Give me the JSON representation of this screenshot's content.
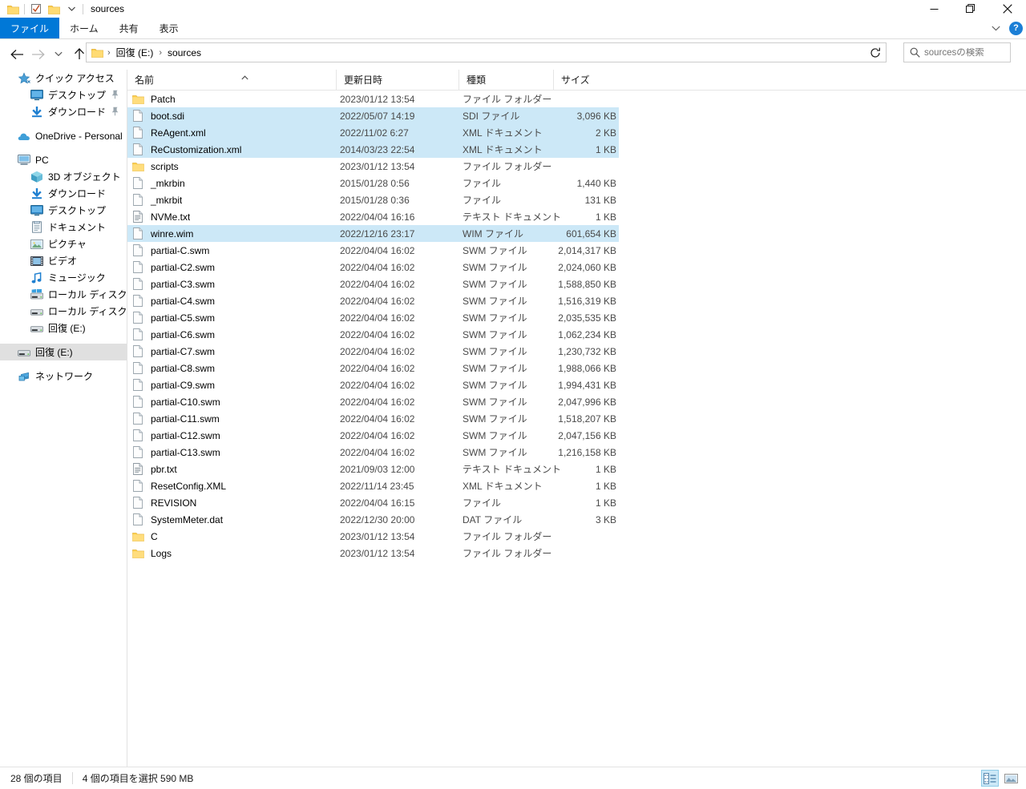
{
  "window": {
    "title": "sources",
    "minimize_label": "─",
    "maximize_label": "❐",
    "close_label": "✕",
    "help_label": "?"
  },
  "ribbon": {
    "tabs": [
      {
        "label": "ファイル",
        "active": true
      },
      {
        "label": "ホーム",
        "active": false
      },
      {
        "label": "共有",
        "active": false
      },
      {
        "label": "表示",
        "active": false
      }
    ]
  },
  "address": {
    "breadcrumbs": [
      "回復 (E:)",
      "sources"
    ],
    "separator": "›",
    "refresh_label": "↻"
  },
  "search": {
    "placeholder": "sourcesの検索",
    "value": ""
  },
  "sidebar": {
    "items": [
      {
        "label": "クイック アクセス",
        "icon": "star-icon",
        "indent": 0,
        "selected": false,
        "pinned": false
      },
      {
        "label": "デスクトップ",
        "icon": "desktop-icon",
        "indent": 1,
        "selected": false,
        "pinned": true
      },
      {
        "label": "ダウンロード",
        "icon": "download-icon",
        "indent": 1,
        "selected": false,
        "pinned": true
      },
      {
        "spacer": true
      },
      {
        "label": "OneDrive - Personal",
        "icon": "cloud-icon",
        "indent": 0,
        "selected": false,
        "pinned": false
      },
      {
        "spacer": true
      },
      {
        "label": "PC",
        "icon": "pc-icon",
        "indent": 0,
        "selected": false,
        "pinned": false
      },
      {
        "label": "3D オブジェクト",
        "icon": "cube-icon",
        "indent": 1,
        "selected": false,
        "pinned": false
      },
      {
        "label": "ダウンロード",
        "icon": "download-icon",
        "indent": 1,
        "selected": false,
        "pinned": false
      },
      {
        "label": "デスクトップ",
        "icon": "desktop-icon",
        "indent": 1,
        "selected": false,
        "pinned": false
      },
      {
        "label": "ドキュメント",
        "icon": "document-icon",
        "indent": 1,
        "selected": false,
        "pinned": false
      },
      {
        "label": "ピクチャ",
        "icon": "picture-icon",
        "indent": 1,
        "selected": false,
        "pinned": false
      },
      {
        "label": "ビデオ",
        "icon": "video-icon",
        "indent": 1,
        "selected": false,
        "pinned": false
      },
      {
        "label": "ミュージック",
        "icon": "music-icon",
        "indent": 1,
        "selected": false,
        "pinned": false
      },
      {
        "label": "ローカル ディスク (C:)",
        "icon": "windows-drive-icon",
        "indent": 1,
        "selected": false,
        "pinned": false
      },
      {
        "label": "ローカル ディスク (D:)",
        "icon": "drive-icon",
        "indent": 1,
        "selected": false,
        "pinned": false
      },
      {
        "label": "回復 (E:)",
        "icon": "drive-icon",
        "indent": 1,
        "selected": false,
        "pinned": false
      },
      {
        "spacer": true
      },
      {
        "label": "回復 (E:)",
        "icon": "drive-icon",
        "indent": 0,
        "selected": true,
        "pinned": false
      },
      {
        "spacer": true
      },
      {
        "label": "ネットワーク",
        "icon": "network-icon",
        "indent": 0,
        "selected": false,
        "pinned": false
      }
    ]
  },
  "filelist": {
    "columns": [
      {
        "label": "名前",
        "key": "name"
      },
      {
        "label": "更新日時",
        "key": "date"
      },
      {
        "label": "種類",
        "key": "type"
      },
      {
        "label": "サイズ",
        "key": "size"
      }
    ],
    "sort_column": "名前",
    "sort_direction": "ascending",
    "rows": [
      {
        "name": "Patch",
        "date": "2023/01/12 13:54",
        "type": "ファイル フォルダー",
        "size": "",
        "icon": "folder-icon",
        "selected": false
      },
      {
        "name": "boot.sdi",
        "date": "2022/05/07 14:19",
        "type": "SDI ファイル",
        "size": "3,096 KB",
        "icon": "file-icon",
        "selected": true
      },
      {
        "name": "ReAgent.xml",
        "date": "2022/11/02 6:27",
        "type": "XML ドキュメント",
        "size": "2 KB",
        "icon": "file-icon",
        "selected": true
      },
      {
        "name": "ReCustomization.xml",
        "date": "2014/03/23 22:54",
        "type": "XML ドキュメント",
        "size": "1 KB",
        "icon": "file-icon",
        "selected": true
      },
      {
        "name": "scripts",
        "date": "2023/01/12 13:54",
        "type": "ファイル フォルダー",
        "size": "",
        "icon": "folder-icon",
        "selected": false
      },
      {
        "name": "_mkrbin",
        "date": "2015/01/28 0:56",
        "type": "ファイル",
        "size": "1,440 KB",
        "icon": "file-icon",
        "selected": false
      },
      {
        "name": "_mkrbit",
        "date": "2015/01/28 0:36",
        "type": "ファイル",
        "size": "131 KB",
        "icon": "file-icon",
        "selected": false
      },
      {
        "name": "NVMe.txt",
        "date": "2022/04/04 16:16",
        "type": "テキスト ドキュメント",
        "size": "1 KB",
        "icon": "text-file-icon",
        "selected": false
      },
      {
        "name": "winre.wim",
        "date": "2022/12/16 23:17",
        "type": "WIM ファイル",
        "size": "601,654 KB",
        "icon": "file-icon",
        "selected": true
      },
      {
        "name": "partial-C.swm",
        "date": "2022/04/04 16:02",
        "type": "SWM ファイル",
        "size": "2,014,317 KB",
        "icon": "file-icon",
        "selected": false
      },
      {
        "name": "partial-C2.swm",
        "date": "2022/04/04 16:02",
        "type": "SWM ファイル",
        "size": "2,024,060 KB",
        "icon": "file-icon",
        "selected": false
      },
      {
        "name": "partial-C3.swm",
        "date": "2022/04/04 16:02",
        "type": "SWM ファイル",
        "size": "1,588,850 KB",
        "icon": "file-icon",
        "selected": false
      },
      {
        "name": "partial-C4.swm",
        "date": "2022/04/04 16:02",
        "type": "SWM ファイル",
        "size": "1,516,319 KB",
        "icon": "file-icon",
        "selected": false
      },
      {
        "name": "partial-C5.swm",
        "date": "2022/04/04 16:02",
        "type": "SWM ファイル",
        "size": "2,035,535 KB",
        "icon": "file-icon",
        "selected": false
      },
      {
        "name": "partial-C6.swm",
        "date": "2022/04/04 16:02",
        "type": "SWM ファイル",
        "size": "1,062,234 KB",
        "icon": "file-icon",
        "selected": false
      },
      {
        "name": "partial-C7.swm",
        "date": "2022/04/04 16:02",
        "type": "SWM ファイル",
        "size": "1,230,732 KB",
        "icon": "file-icon",
        "selected": false
      },
      {
        "name": "partial-C8.swm",
        "date": "2022/04/04 16:02",
        "type": "SWM ファイル",
        "size": "1,988,066 KB",
        "icon": "file-icon",
        "selected": false
      },
      {
        "name": "partial-C9.swm",
        "date": "2022/04/04 16:02",
        "type": "SWM ファイル",
        "size": "1,994,431 KB",
        "icon": "file-icon",
        "selected": false
      },
      {
        "name": "partial-C10.swm",
        "date": "2022/04/04 16:02",
        "type": "SWM ファイル",
        "size": "2,047,996 KB",
        "icon": "file-icon",
        "selected": false
      },
      {
        "name": "partial-C11.swm",
        "date": "2022/04/04 16:02",
        "type": "SWM ファイル",
        "size": "1,518,207 KB",
        "icon": "file-icon",
        "selected": false
      },
      {
        "name": "partial-C12.swm",
        "date": "2022/04/04 16:02",
        "type": "SWM ファイル",
        "size": "2,047,156 KB",
        "icon": "file-icon",
        "selected": false
      },
      {
        "name": "partial-C13.swm",
        "date": "2022/04/04 16:02",
        "type": "SWM ファイル",
        "size": "1,216,158 KB",
        "icon": "file-icon",
        "selected": false
      },
      {
        "name": "pbr.txt",
        "date": "2021/09/03 12:00",
        "type": "テキスト ドキュメント",
        "size": "1 KB",
        "icon": "text-file-icon",
        "selected": false
      },
      {
        "name": "ResetConfig.XML",
        "date": "2022/11/14 23:45",
        "type": "XML ドキュメント",
        "size": "1 KB",
        "icon": "file-icon",
        "selected": false
      },
      {
        "name": "REVISION",
        "date": "2022/04/04 16:15",
        "type": "ファイル",
        "size": "1 KB",
        "icon": "file-icon",
        "selected": false
      },
      {
        "name": "SystemMeter.dat",
        "date": "2022/12/30 20:00",
        "type": "DAT ファイル",
        "size": "3 KB",
        "icon": "file-icon",
        "selected": false
      },
      {
        "name": "C",
        "date": "2023/01/12 13:54",
        "type": "ファイル フォルダー",
        "size": "",
        "icon": "folder-icon",
        "selected": false
      },
      {
        "name": "Logs",
        "date": "2023/01/12 13:54",
        "type": "ファイル フォルダー",
        "size": "",
        "icon": "folder-icon",
        "selected": false
      }
    ]
  },
  "statusbar": {
    "item_count": "28 個の項目",
    "selection": "4 個の項目を選択  590 MB",
    "view_details_title": "詳細",
    "view_largeicons_title": "大アイコン"
  },
  "colors": {
    "accent": "#0078d7",
    "selection": "#cce8f7",
    "folder": "#ffd04b",
    "sidebar_selected": "#e0e0e0"
  }
}
